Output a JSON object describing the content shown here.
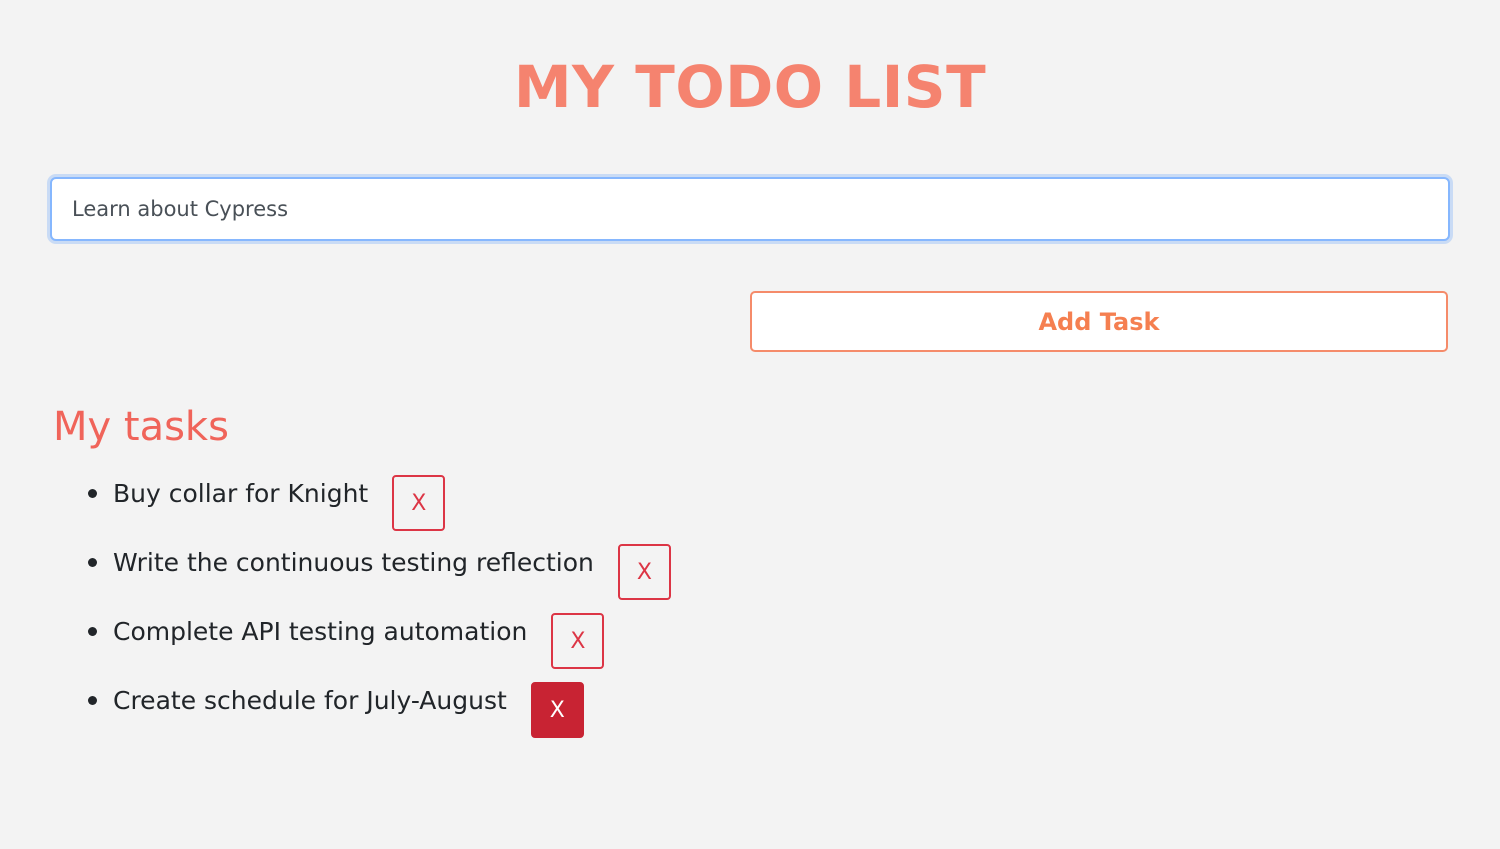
{
  "header": {
    "title": "MY TODO LIST"
  },
  "form": {
    "input_value": "Learn about Cypress",
    "add_label": "Add Task"
  },
  "tasks_section": {
    "title": "My tasks",
    "delete_label": "X",
    "items": [
      {
        "text": "Buy collar for Knight"
      },
      {
        "text": "Write the continuous testing reflection"
      },
      {
        "text": "Complete API testing automation"
      },
      {
        "text": "Create schedule for July-August"
      }
    ]
  },
  "colors": {
    "title": "#f5836f",
    "subtitle": "#f0645a",
    "add_button": "#f57f50",
    "delete": "#dc3545",
    "delete_hover": "#c82333",
    "input_focus": "#86b7fe",
    "background": "#f3f3f3"
  }
}
